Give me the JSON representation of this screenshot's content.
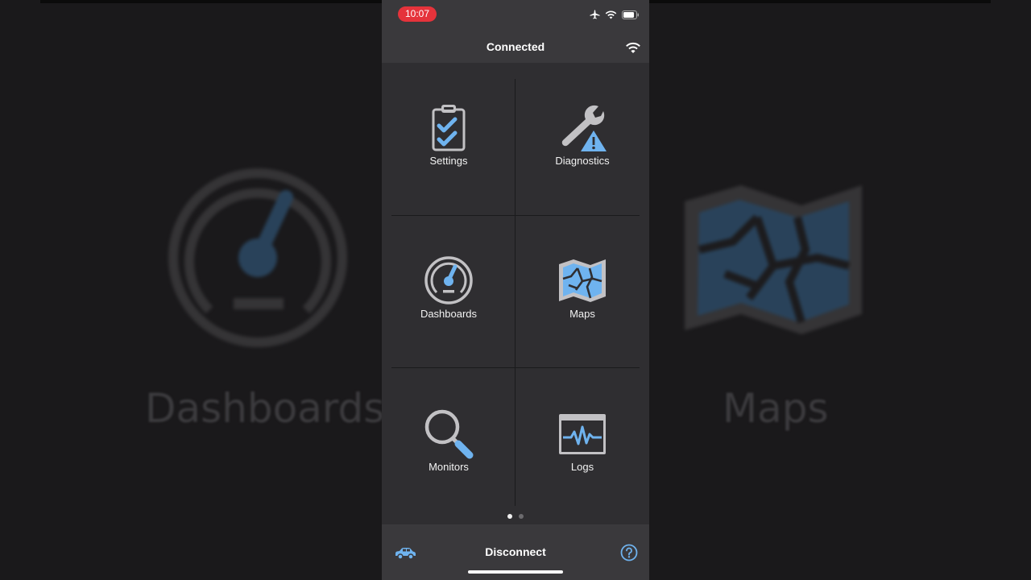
{
  "background": {
    "left_label": "Dashboards",
    "right_label": "Maps"
  },
  "status_bar": {
    "time": "10:07",
    "icons": [
      "airplane-icon",
      "wifi-icon",
      "battery-icon"
    ]
  },
  "nav": {
    "title": "Connected",
    "right_icon": "wifi-icon"
  },
  "menu": [
    {
      "label": "Settings",
      "icon": "clipboard-check-icon"
    },
    {
      "label": "Diagnostics",
      "icon": "wrench-warning-icon"
    },
    {
      "label": "Dashboards",
      "icon": "gauge-icon"
    },
    {
      "label": "Maps",
      "icon": "map-icon"
    },
    {
      "label": "Monitors",
      "icon": "magnifier-icon"
    },
    {
      "label": "Logs",
      "icon": "waveform-window-icon"
    }
  ],
  "pager": {
    "pages": 2,
    "current": 1
  },
  "bottom_bar": {
    "left_icon": "car-icon",
    "action_label": "Disconnect",
    "right_icon": "help-icon"
  },
  "colors": {
    "accent": "#6fb3ef",
    "time_pill": "#e5333b",
    "bar_bg": "#3a393c",
    "grid_bg": "#2f2e31"
  }
}
